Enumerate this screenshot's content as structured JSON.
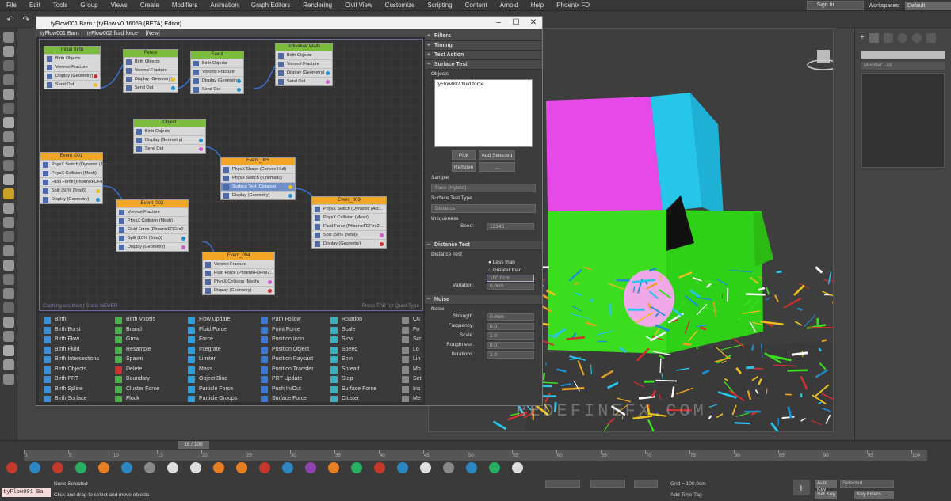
{
  "menu": [
    "File",
    "Edit",
    "Tools",
    "Group",
    "Views",
    "Create",
    "Modifiers",
    "Animation",
    "Graph Editors",
    "Rendering",
    "Civil View",
    "Customize",
    "Scripting",
    "Content",
    "Arnold",
    "Help",
    "Phoenix FD"
  ],
  "signin": "Sign In",
  "workspaces_label": "Workspaces:",
  "workspace_value": "Default",
  "editor": {
    "title": "tyFlow001 Barn : [tyFlow v0.16069 (BETA) Editor]",
    "tabs": [
      "tyFlow001 Barn",
      "tyFlow002 fluid force",
      "[New]"
    ],
    "status_left": "Caching enabled | Static NEVER",
    "status_right": "Press TAB for QuickType"
  },
  "nodes": [
    {
      "title": "Initial Birth",
      "hdr": "g",
      "ops": [
        "Birth Objects",
        "Voronoi Fracture",
        "Display (Geometry)",
        "Send Out"
      ]
    },
    {
      "title": "Fence",
      "hdr": "g",
      "ops": [
        "Birth Objects",
        "Voronoi Fracture",
        "Display (Geometry)",
        "Send Out"
      ]
    },
    {
      "title": "Event",
      "hdr": "g",
      "ops": [
        "Birth Objects",
        "Voronoi Fracture",
        "Display (Geometry)",
        "Send Out"
      ]
    },
    {
      "title": "Individual Walls",
      "hdr": "g",
      "ops": [
        "Birth Objects",
        "Voronoi Fracture",
        "Display (Geometry)",
        "Send Out"
      ]
    },
    {
      "title": "Object",
      "hdr": "g",
      "ops": [
        "Birth Objects",
        "Display (Geometry)",
        "Send Out"
      ]
    },
    {
      "title": "Event_001",
      "hdr": "o",
      "ops": [
        "PhysX Switch (Dynamic (Act...",
        "PhysX Collision (Mesh)",
        "Fluid Force (PhoenixFDFire2...",
        "Split (50% (Total))",
        "Display (Geometry)"
      ]
    },
    {
      "title": "Event_005",
      "hdr": "o",
      "ops": [
        "PhysX Shape (Convex Hull)",
        "PhysX Switch (Kinematic)",
        "Surface Test (Distance)",
        "Display (Geometry)"
      ]
    },
    {
      "title": "Event_002",
      "hdr": "o",
      "ops": [
        "Voronoi Fracture",
        "PhysX Collision (Mesh)",
        "Fluid Force (PhoenixFDFire2...",
        "Split (10% (Total))",
        "Display (Geometry)"
      ]
    },
    {
      "title": "Event_003",
      "hdr": "o",
      "ops": [
        "PhysX Switch (Dynamic (Act...",
        "PhysX Collision (Mesh)",
        "Fluid Force (PhoenixFDFire2...",
        "Split (50% (Total))",
        "Display (Geometry)"
      ]
    },
    {
      "title": "Event_004",
      "hdr": "o",
      "ops": [
        "Voronoi Fracture",
        "Fluid Force (PhoenixFDFire2...",
        "PhysX Collision (Mesh)",
        "Display (Geometry)"
      ]
    }
  ],
  "props": {
    "sections": [
      "Filters",
      "Timing",
      "Test Action",
      "Surface Test"
    ],
    "objects_label": "Objects",
    "objects_value": "tyFlow002 fluid force",
    "pick": "Pick",
    "add_selected": "Add Selected",
    "remove": "Remove",
    "dots": "...",
    "sample_label": "Sample",
    "sample_value": "Face (Hybrid)",
    "surface_test_type_label": "Surface Test Type",
    "surface_test_type_value": "Distance",
    "uniqueness_label": "Uniqueness",
    "seed_label": "Seed:",
    "seed_value": "12345",
    "distance_section": "Distance Test",
    "distance_sub": "Distance Test",
    "less_than": "Less than",
    "greater_than": "Greater than",
    "distance_value": "100.0cm",
    "variation_label": "Variation:",
    "variation_value": "0.0cm",
    "noise_section": "Noise",
    "noise_sub": "Noise",
    "noise_rows": [
      [
        "Strength:",
        "0.0cm"
      ],
      [
        "Frequency:",
        "0.0"
      ],
      [
        "Scale:",
        "1.0"
      ],
      [
        "Roughness:",
        "0.0"
      ],
      [
        "Iterations:",
        "1.0"
      ]
    ]
  },
  "operators": [
    [
      "Birth",
      "Birth Burst",
      "Birth Flow",
      "Birth Fluid",
      "Birth Intersections",
      "Birth Objects",
      "Birth PRT",
      "Birth Spline",
      "Birth Surface"
    ],
    [
      "Birth Voxels",
      "Branch",
      "Grow",
      "Resample",
      "Spawn",
      "Delete",
      "Boundary",
      "Cluster Force",
      "Flock"
    ],
    [
      "Flow Update",
      "Fluid Force",
      "Force",
      "Integrate",
      "Limiter",
      "Mass",
      "Object Bind",
      "Particle Force",
      "Particle Groups"
    ],
    [
      "Path Follow",
      "Point Force",
      "Position Icon",
      "Position Object",
      "Position Raycast",
      "Position Transfer",
      "PRT Update",
      "Push In/Out",
      "Surface Force"
    ],
    [
      "Rotation",
      "Scale",
      "Slow",
      "Speed",
      "Spin",
      "Spread",
      "Stop",
      "Surface Force",
      "Cluster"
    ],
    [
      "Cu",
      "Fo",
      "Scr",
      "Lo",
      "Lin",
      "Mo",
      "Set",
      "Ins",
      "Me"
    ]
  ],
  "timeline": {
    "frame": "16 / 100",
    "ticks": [
      "0",
      "5",
      "10",
      "15",
      "20",
      "25",
      "30",
      "35",
      "40",
      "45",
      "50",
      "55",
      "60",
      "65",
      "70",
      "75",
      "80",
      "85",
      "90",
      "95",
      "100"
    ]
  },
  "status": {
    "script_box": "tyFlow001 Ba",
    "line1": "None Selected",
    "line2": "Click and drag to select and move objects",
    "grid": "Grid = 100.0cm",
    "add_time_tag": "Add Time Tag",
    "auto_key": "Auto Key",
    "set_key": "Set Key",
    "selected": "Selected",
    "key_filters": "Key Filters..."
  },
  "modifier_list": "Modifier List",
  "watermark": "REDEFINEFX.COM"
}
